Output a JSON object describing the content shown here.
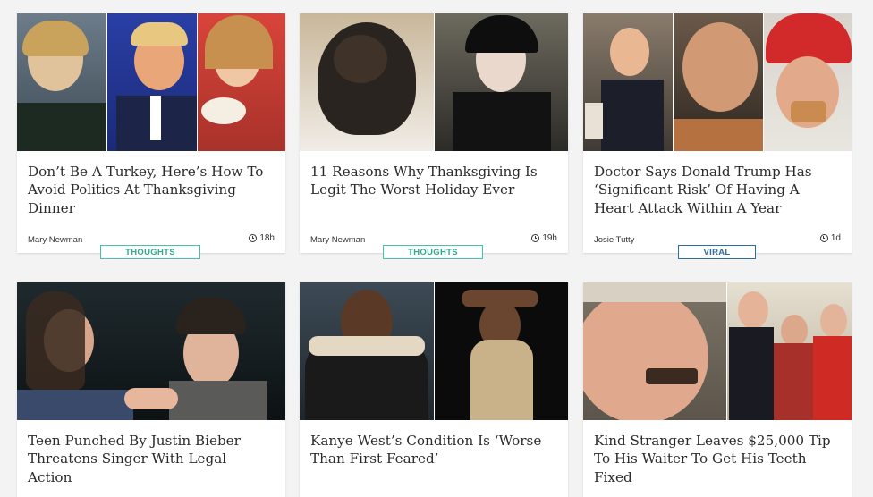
{
  "articles": [
    {
      "title": "Don’t Be A Turkey, Here’s How To Avoid Politics At Thanksgiving Dinner",
      "author": "Mary Newman",
      "time": "18h",
      "tag": "THOUGHTS"
    },
    {
      "title": "11 Reasons Why Thanksgiving Is Legit The Worst Holiday Ever",
      "author": "Mary Newman",
      "time": "19h",
      "tag": "THOUGHTS"
    },
    {
      "title": "Doctor Says Donald Trump Has ‘Significant Risk’ Of Having A Heart Attack Within A Year",
      "author": "Josie Tutty",
      "time": "1d",
      "tag": "VIRAL"
    },
    {
      "title": "Teen Punched By Justin Bieber Threatens Singer With Legal Action"
    },
    {
      "title": "Kanye West’s Condition Is ‘Worse Than First Feared’"
    },
    {
      "title": "Kind Stranger Leaves $25,000 Tip To His Waiter To Get His Teeth Fixed"
    }
  ],
  "icons": {
    "time": "clock-icon"
  },
  "colors": {
    "thoughts": "#46c2a8",
    "viral": "#2e6da4",
    "background": "#f3f3f3"
  }
}
